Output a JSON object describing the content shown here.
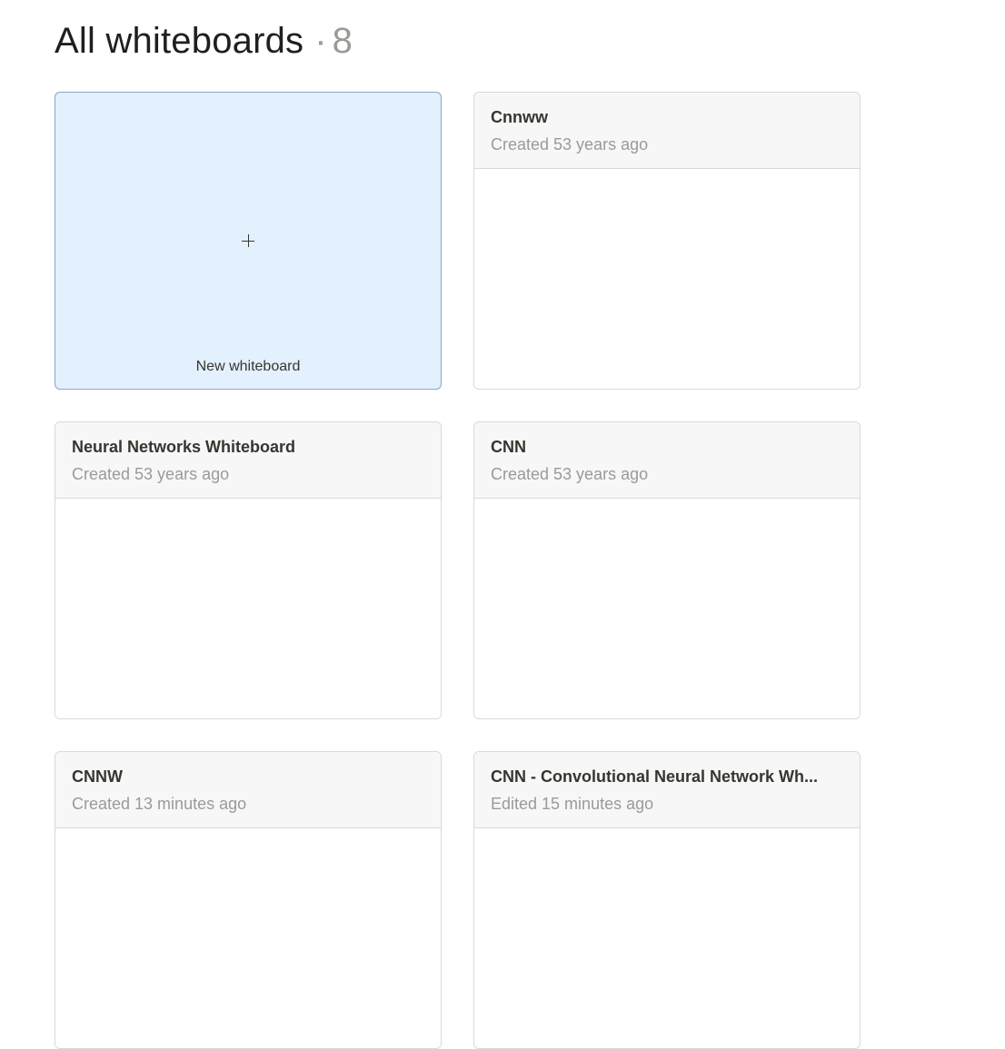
{
  "header": {
    "title": "All whiteboards",
    "separator": "·",
    "count": "8"
  },
  "new_card": {
    "label": "New whiteboard",
    "icon": "plus-icon"
  },
  "cards": [
    {
      "title": "Cnnww",
      "meta": "Created 53 years ago"
    },
    {
      "title": "Neural Networks Whiteboard",
      "meta": "Created 53 years ago"
    },
    {
      "title": "CNN",
      "meta": "Created 53 years ago"
    },
    {
      "title": "CNNW",
      "meta": "Created 13 minutes ago"
    },
    {
      "title": "CNN - Convolutional Neural Network Wh...",
      "meta": "Edited 15 minutes ago"
    }
  ],
  "colors": {
    "new_card_bg": "#e3f0fd",
    "new_card_border": "#8aa6c2",
    "card_header_bg": "#f7f7f7",
    "muted_text": "#9b9a97"
  }
}
